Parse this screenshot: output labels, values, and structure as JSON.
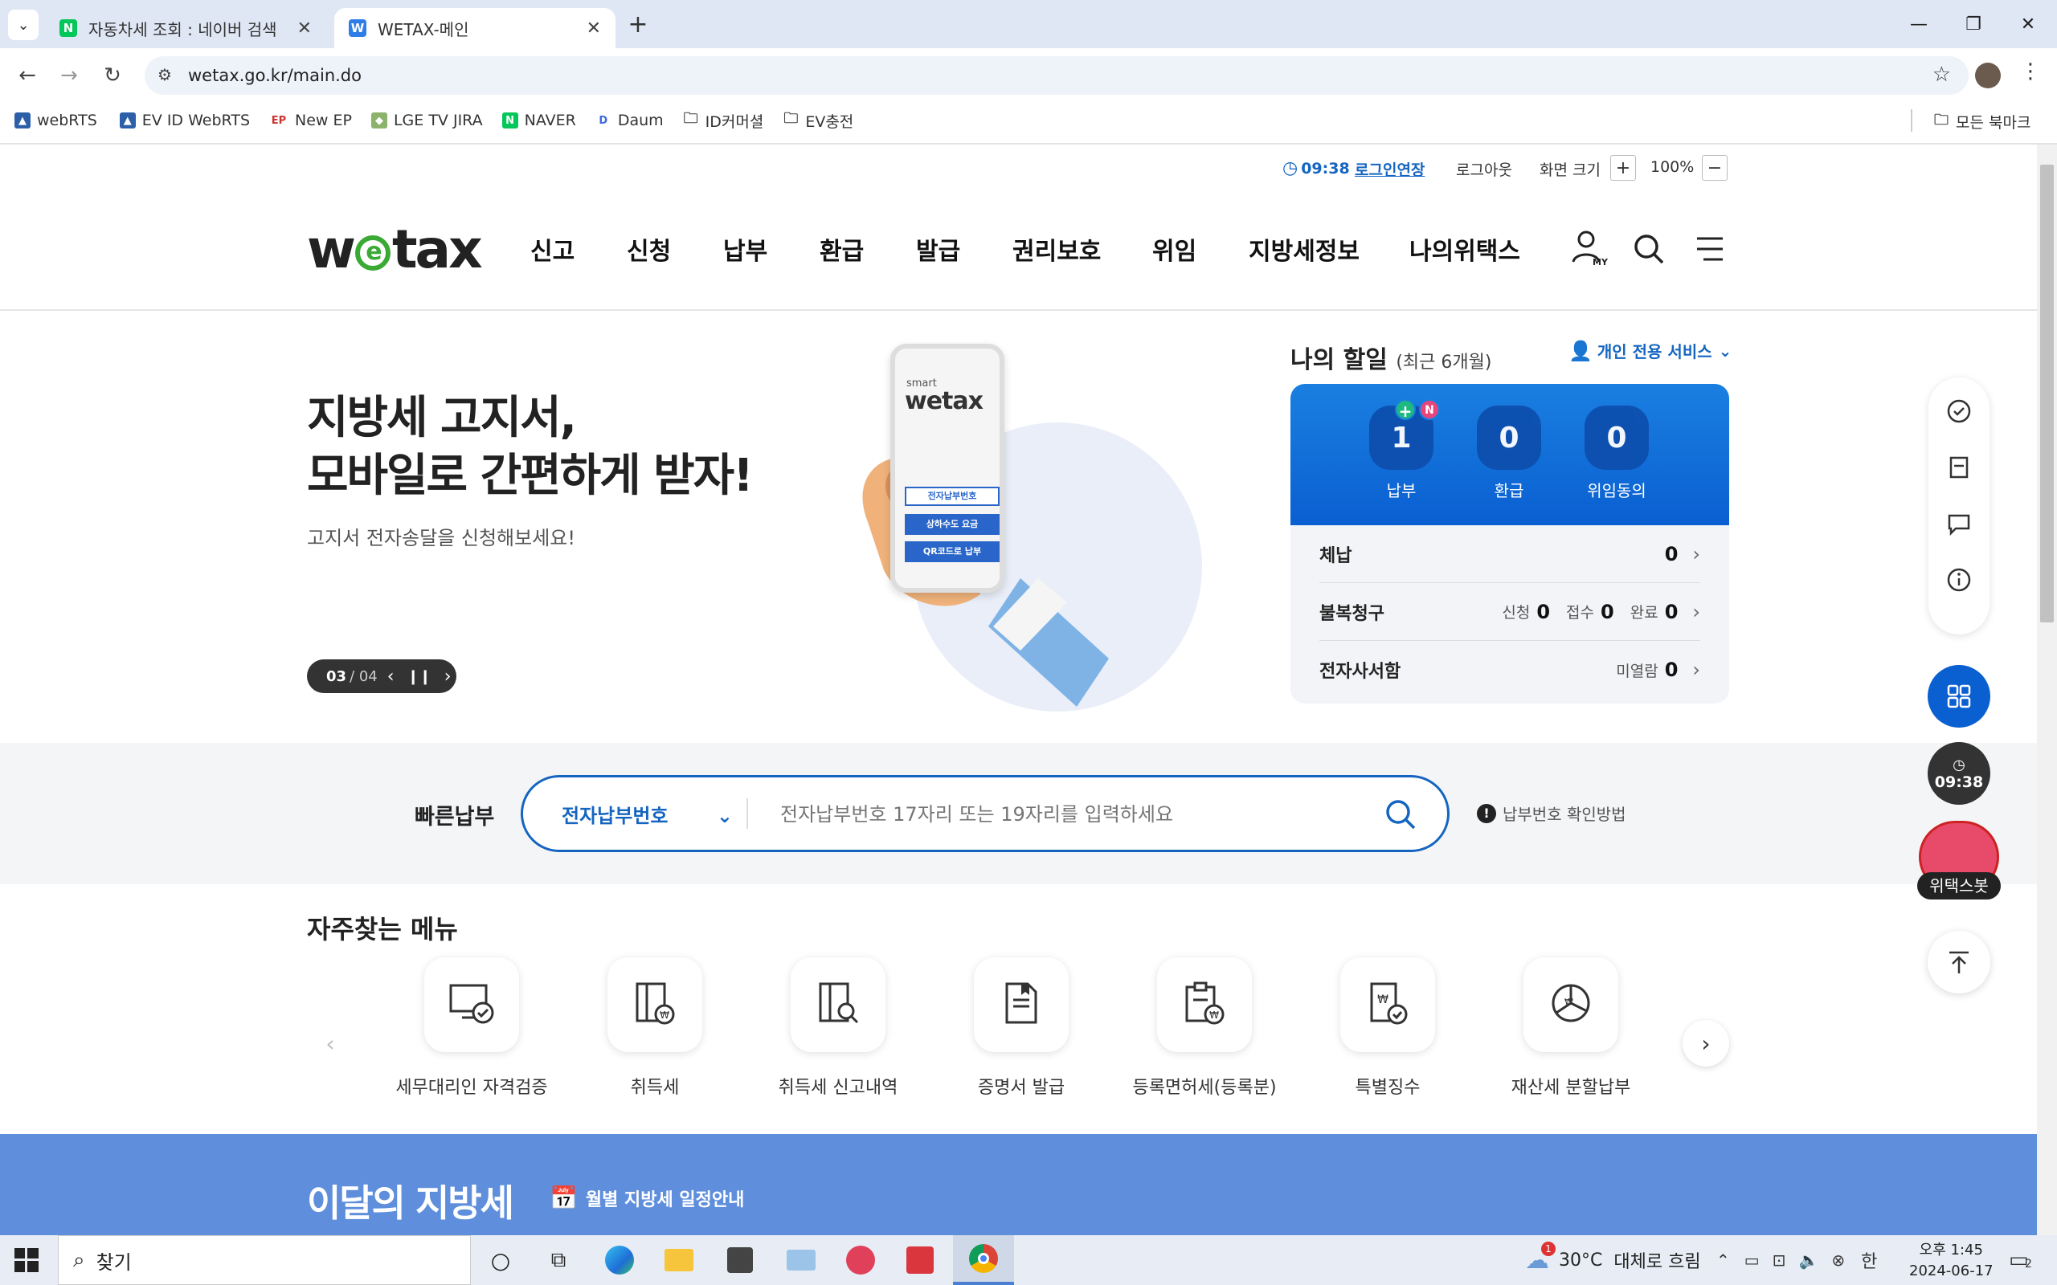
{
  "browser": {
    "tabs": [
      {
        "title": "자동차세 조회 : 네이버 검색",
        "favicon": "N",
        "favicon_color": "#03c75a"
      },
      {
        "title": "WETAX-메인",
        "favicon": "W",
        "favicon_color": "#2f7ee8"
      }
    ],
    "url": "wetax.go.kr/main.do",
    "bookmarks": [
      {
        "label": "webRTS",
        "icon": "rts-icon"
      },
      {
        "label": "EV ID WebRTS",
        "icon": "rts-icon"
      },
      {
        "label": "New EP",
        "icon": "ep-icon"
      },
      {
        "label": "LGE TV JIRA",
        "icon": "jira-icon"
      },
      {
        "label": "NAVER",
        "icon": "naver-icon"
      },
      {
        "label": "Daum",
        "icon": "daum-icon"
      },
      {
        "label": "ID커머셜",
        "icon": "folder-icon"
      },
      {
        "label": "EV충전",
        "icon": "folder-icon"
      }
    ],
    "all_bookmarks": "모든 북마크"
  },
  "util": {
    "session_time": "09:38",
    "extend_login": "로그인연장",
    "logout": "로그아웃",
    "zoom_label": "화면 크기",
    "zoom_value": "100%"
  },
  "header": {
    "logo": "wetax",
    "menu": [
      "신고",
      "신청",
      "납부",
      "환급",
      "발급",
      "권리보호",
      "위임",
      "지방세정보",
      "나의위택스"
    ],
    "my_badge": "MY"
  },
  "hero": {
    "headline_line1": "지방세 고지서,",
    "headline_line2": "모바일로 간편하게 받자!",
    "subtext": "고지서 전자송달을 신청해보세요!",
    "pager_current": "03",
    "pager_total": "/ 04",
    "phone_brand_small": "smart",
    "phone_brand": "wetax",
    "phone_buttons": [
      "전자납부번호",
      "상하수도 요금",
      "QR코드로 납부"
    ]
  },
  "my_tax": {
    "title": "나의 할일",
    "period": "(최근 6개월)",
    "service_link": "개인 전용 서비스",
    "stats": [
      {
        "label": "납부",
        "value": "1",
        "badge_plus": "+",
        "badge_new": "N"
      },
      {
        "label": "환급",
        "value": "0"
      },
      {
        "label": "위임동의",
        "value": "0"
      }
    ],
    "rows": [
      {
        "label": "체납",
        "value": "0"
      },
      {
        "label": "불복청구",
        "sub": [
          {
            "k": "신청",
            "v": "0"
          },
          {
            "k": "접수",
            "v": "0"
          },
          {
            "k": "완료",
            "v": "0"
          }
        ]
      },
      {
        "label": "전자사서함",
        "sub": [
          {
            "k": "미열람",
            "v": "0"
          }
        ]
      }
    ]
  },
  "quick_pay": {
    "label": "빠른납부",
    "select_value": "전자납부번호",
    "placeholder": "전자납부번호 17자리 또는 19자리를 입력하세요",
    "help": "납부번호 확인방법"
  },
  "frequent": {
    "title": "자주찾는 메뉴",
    "items": [
      {
        "label": "세무대리인 자격검증",
        "icon": "tax-agent-verify-icon"
      },
      {
        "label": "취득세",
        "icon": "acquisition-tax-icon"
      },
      {
        "label": "취득세 신고내역",
        "icon": "acquisition-history-icon"
      },
      {
        "label": "증명서 발급",
        "icon": "certificate-icon"
      },
      {
        "label": "등록면허세(등록분)",
        "icon": "registration-tax-icon"
      },
      {
        "label": "특별징수",
        "icon": "special-collection-icon"
      },
      {
        "label": "재산세 분할납부",
        "icon": "property-tax-split-icon"
      }
    ]
  },
  "monthly": {
    "title": "이달의 지방세",
    "link": "월별 지방세 일정안내"
  },
  "floating": {
    "timer": "09:38",
    "bot_label": "위택스봇"
  },
  "taskbar": {
    "search": "찾기",
    "weather_temp": "30°C",
    "weather_desc": "대체로 흐림",
    "weather_badge": "1",
    "ime": "한",
    "time": "오후 1:45",
    "date": "2024-06-17",
    "notif_count": "2"
  },
  "colors": {
    "brand_blue": "#1565c0",
    "card_blue": "#0a5fd1",
    "band_blue": "#5f8fdc",
    "logo_green": "#3aaa35"
  }
}
